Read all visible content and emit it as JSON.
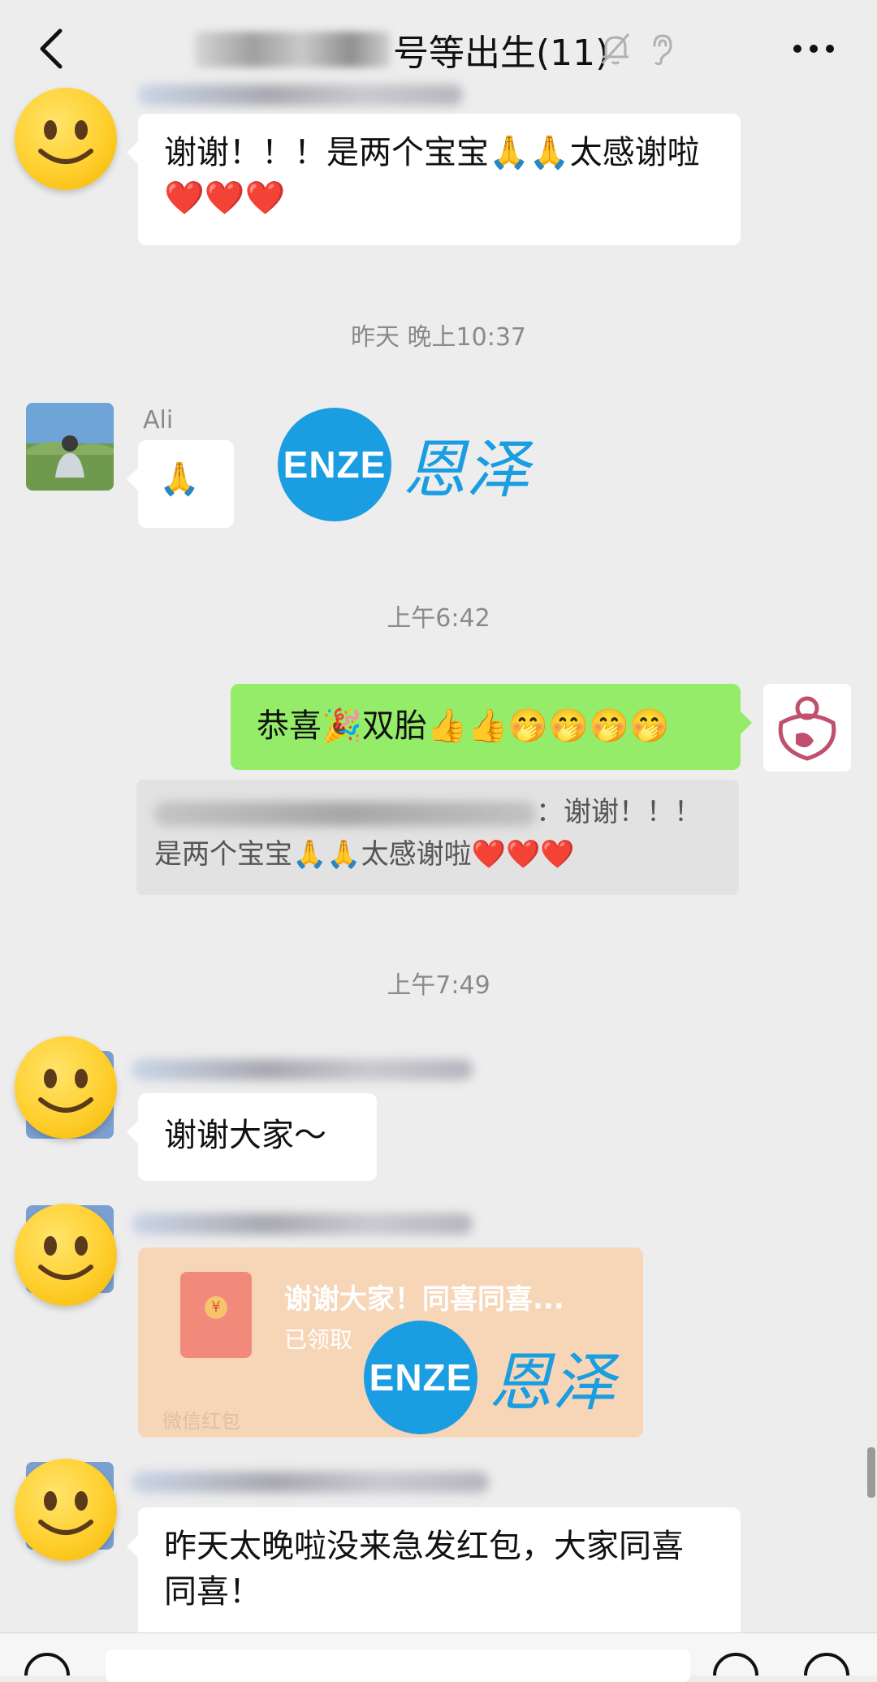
{
  "header": {
    "title_visible": "号等出生(11)",
    "icons": [
      "back-icon",
      "mute-icon",
      "ear-icon",
      "more-icon"
    ]
  },
  "messages": [
    {
      "type": "text",
      "side": "left",
      "avatar": "smiley-avatar",
      "sender_name": "",
      "text": "谢谢！！！是两个宝宝🙏🙏太感谢啦❤️❤️❤️"
    },
    {
      "type": "timestamp",
      "text": "昨天 晚上10:37"
    },
    {
      "type": "text",
      "side": "left",
      "avatar": "landscape-avatar",
      "sender_name": "Ali",
      "text": "🙏"
    },
    {
      "type": "timestamp",
      "text": "上午6:42"
    },
    {
      "type": "text",
      "side": "right",
      "avatar": "logo-avatar",
      "text": "恭喜🎉双胎👍👍🤭🤭🤭🤭",
      "quote": "：谢谢！！！是两个宝宝🙏🙏太感谢啦❤️❤️❤️"
    },
    {
      "type": "timestamp",
      "text": "上午7:49"
    },
    {
      "type": "text",
      "side": "left",
      "avatar": "smiley-avatar",
      "text": "谢谢大家～"
    },
    {
      "type": "red_packet",
      "side": "left",
      "avatar": "smiley-avatar",
      "title": "谢谢大家！同喜同喜...",
      "status": "已领取",
      "label": "微信红包"
    },
    {
      "type": "text",
      "side": "left",
      "avatar": "smiley-avatar",
      "text": "昨天太晚啦没来急发红包，大家同喜同喜！"
    }
  ],
  "watermark": {
    "logo_text": "ENZE",
    "brand_text": "恩泽"
  },
  "colors": {
    "background": "#ededed",
    "bubble_white": "#ffffff",
    "bubble_green": "#95ec69",
    "red_packet": "#f7d6b8",
    "brand_blue": "#1a9de1"
  }
}
